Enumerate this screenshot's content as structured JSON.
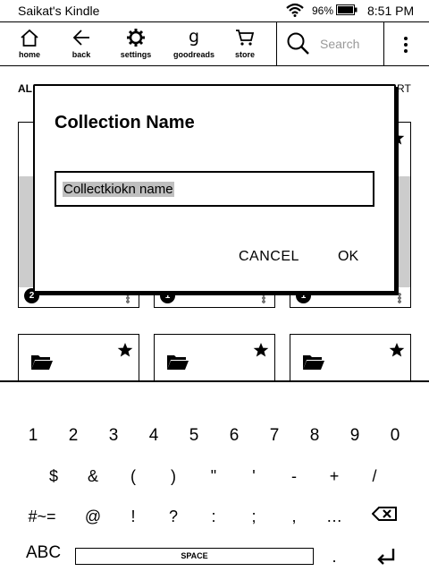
{
  "status_bar": {
    "device_name": "Saikat's Kindle",
    "battery_percent": "96%",
    "time": "8:51 PM"
  },
  "toolbar": {
    "items": [
      {
        "label": "home",
        "icon": "home-icon"
      },
      {
        "label": "back",
        "icon": "back-arrow-icon"
      },
      {
        "label": "settings",
        "icon": "gear-icon"
      },
      {
        "label": "goodreads",
        "icon": "goodreads-icon"
      },
      {
        "label": "store",
        "icon": "cart-icon"
      }
    ],
    "search_placeholder": "Search"
  },
  "library": {
    "filter_label": "AL",
    "sort_label": "RT",
    "tiles_row1": [
      {
        "badge": "2",
        "icon": "star-icon"
      },
      {
        "badge": "1"
      },
      {
        "badge": "1",
        "icon": "star-icon"
      }
    ],
    "tiles_row2": [
      {
        "icon": "folder-icon"
      },
      {
        "icon": "folder-icon"
      },
      {
        "icon": "folder-icon"
      }
    ]
  },
  "dialog": {
    "title": "Collection Name",
    "input_value": "Collectkiokn name",
    "cancel_label": "CANCEL",
    "ok_label": "OK"
  },
  "keyboard": {
    "row1": [
      "1",
      "2",
      "3",
      "4",
      "5",
      "6",
      "7",
      "8",
      "9",
      "0"
    ],
    "row2": [
      "$",
      "&",
      "(",
      ")",
      "\"",
      "'",
      "-",
      "+",
      "/"
    ],
    "row3": [
      "#~=",
      "@",
      "!",
      "?",
      ":",
      ";",
      ",",
      "…"
    ],
    "mode_key": "ABC",
    "space_label": "SPACE",
    "period_key": "."
  }
}
